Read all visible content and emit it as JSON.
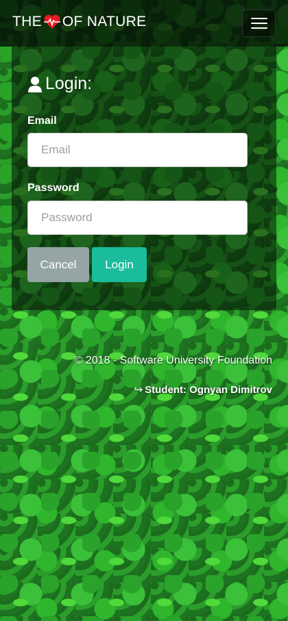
{
  "navbar": {
    "brand_prefix": "THE",
    "brand_suffix": "OF NATURE",
    "brand_icon": "heart-pulse-icon",
    "menu_icon": "hamburger-menu-icon"
  },
  "login": {
    "title": "Login:",
    "title_icon": "user-icon",
    "email_label": "Email",
    "email_placeholder": "Email",
    "email_value": "",
    "password_label": "Password",
    "password_placeholder": "Password",
    "password_value": "",
    "cancel_label": "Cancel",
    "login_label": "Login"
  },
  "footer": {
    "copyright": "© 2018 - Software University Foundation",
    "student": "Student: Ognyan Dimitrov",
    "student_icon": "sign-in-arrow-icon"
  },
  "colors": {
    "cancel_button": "#95a5a6",
    "login_button": "#1abc9c",
    "heart": "#e31b23"
  }
}
